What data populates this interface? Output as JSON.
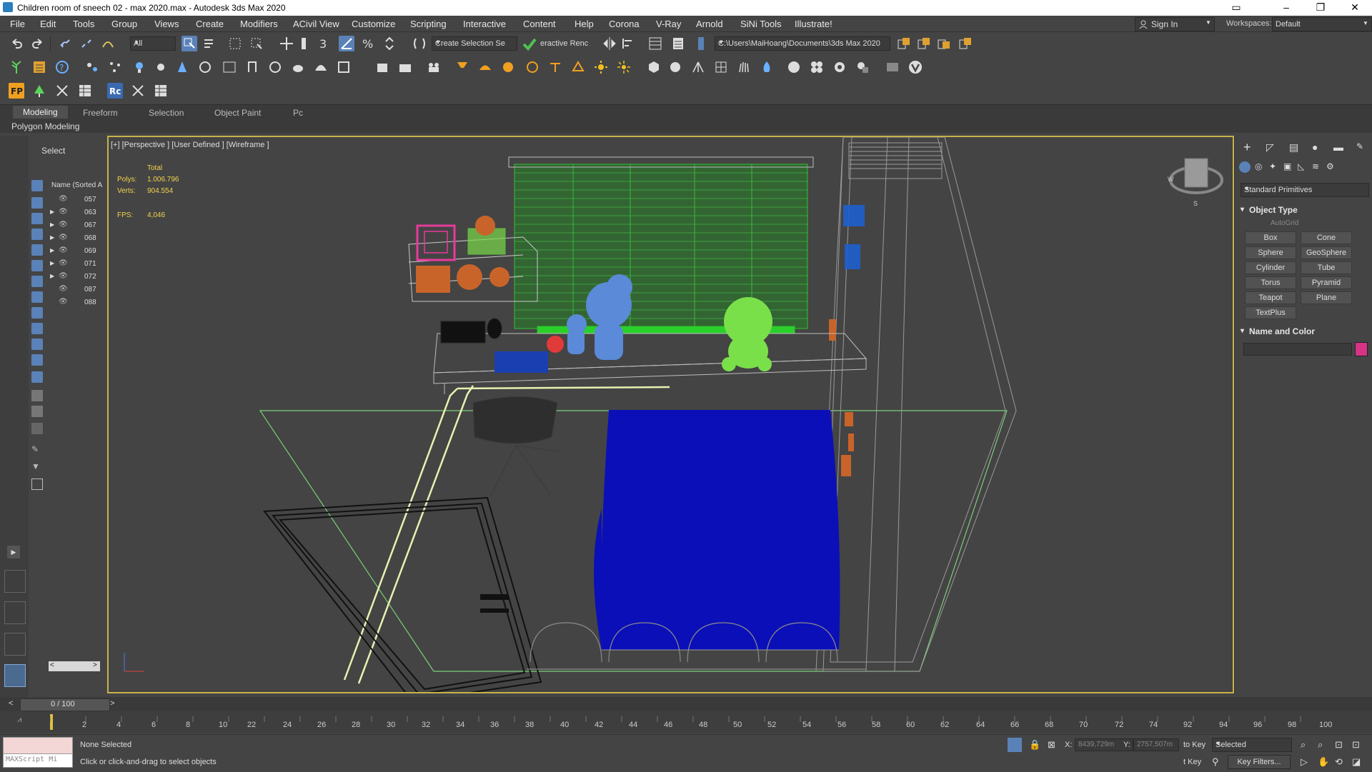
{
  "window": {
    "title": "Children room of sneech 02 - max 2020.max - Autodesk 3ds Max 2020"
  },
  "menu": [
    "File",
    "Edit",
    "Tools",
    "Group",
    "Views",
    "Create",
    "Modifiers",
    "ACivil View",
    "Customize",
    "Scripting",
    "Interactive",
    "Content",
    "Help",
    "Corona",
    "V-Ray",
    "Arnold",
    "SiNi Tools",
    "Illustrate!"
  ],
  "header": {
    "sign_in": "Sign In",
    "workspaces_label": "Workspaces:",
    "workspace": "Default"
  },
  "toolbar": {
    "filter": "All",
    "selection_set": "Create Selection Se",
    "render_label": "eractive Renc",
    "project_path": "C:\\Users\\MaiHoang\\Documents\\3ds Max 2020"
  },
  "ribbon": {
    "tabs": [
      "Modeling",
      "Freeform",
      "Selection",
      "Object Paint",
      "Pc"
    ],
    "panel": "Polygon Modeling"
  },
  "scene_explorer": {
    "select_label": "Select",
    "column": "Name (Sorted A",
    "rows": [
      "057",
      "063",
      "067",
      "068",
      "069",
      "071",
      "072",
      "087",
      "088"
    ]
  },
  "viewport": {
    "label": "[+] [Perspective ] [User Defined ] [Wireframe ]",
    "stats": {
      "total_label": "Total",
      "polys_label": "Polys:",
      "polys": "1.006.796",
      "verts_label": "Verts:",
      "verts": "904.554",
      "fps_label": "FPS:",
      "fps": "4,046"
    },
    "viewcube_w": "W",
    "viewcube_s": "S"
  },
  "command_panel": {
    "category": "Standard Primitives",
    "object_type_title": "Object Type",
    "autogrid": "AutoGrid",
    "buttons": [
      "Box",
      "Cone",
      "Sphere",
      "GeoSphere",
      "Cylinder",
      "Tube",
      "Torus",
      "Pyramid",
      "Teapot",
      "Plane",
      "TextPlus"
    ],
    "name_color_title": "Name and Color",
    "color": "#d63384"
  },
  "timeline": {
    "frame": "0 / 100",
    "ticks": [
      "2",
      "4",
      "6",
      "8",
      "10",
      "22",
      "24",
      "26",
      "28",
      "30",
      "32",
      "34",
      "36",
      "38",
      "40",
      "42",
      "44",
      "46",
      "48",
      "50",
      "52",
      "54",
      "56",
      "58",
      "60",
      "62",
      "64",
      "66",
      "68",
      "70",
      "72",
      "74",
      "92",
      "94",
      "96",
      "98",
      "100"
    ]
  },
  "status": {
    "maxscript": "MAXScript Mi",
    "selection": "None Selected",
    "prompt": "Click or click-and-drag to select objects",
    "x_label": "X:",
    "x_value": "8439,729m",
    "y_label": "Y:",
    "y_value": "2757,507m",
    "auto_key": "to Key",
    "set_key": "t Key",
    "selected": "Selected",
    "key_filters": "Key Filters..."
  },
  "colors": {
    "accent": "#c8b34a",
    "viewport_bg": "#444444"
  }
}
